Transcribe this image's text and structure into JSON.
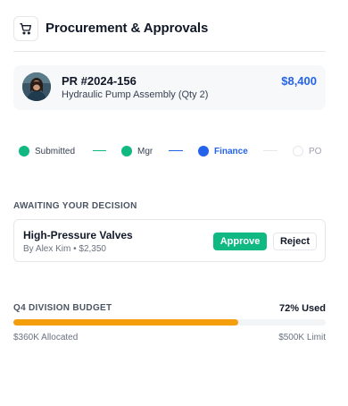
{
  "header": {
    "title": "Procurement & Approvals",
    "icon": "cart-icon"
  },
  "request": {
    "number": "PR #2024-156",
    "description": "Hydraulic Pump Assembly (Qty 2)",
    "amount": "$8,400"
  },
  "workflow": {
    "steps": [
      {
        "label": "Submitted",
        "state": "done",
        "color": "#10b981"
      },
      {
        "label": "Mgr",
        "state": "done",
        "color": "#10b981"
      },
      {
        "label": "Finance",
        "state": "current",
        "color": "#2563eb"
      },
      {
        "label": "PO",
        "state": "pending",
        "color": "#d1d5db"
      }
    ]
  },
  "decision": {
    "section_label": "AWAITING YOUR DECISION",
    "item_title": "High-Pressure Valves",
    "item_sub": "By Alex Kim • $2,350",
    "approve_label": "Approve",
    "reject_label": "Reject"
  },
  "budget": {
    "section_label": "Q4 DIVISION BUDGET",
    "used_label": "72% Used",
    "used_fraction": 0.72,
    "allocated_label": "$360K Allocated",
    "limit_label": "$500K Limit",
    "bar_color": "#f59e0b"
  }
}
